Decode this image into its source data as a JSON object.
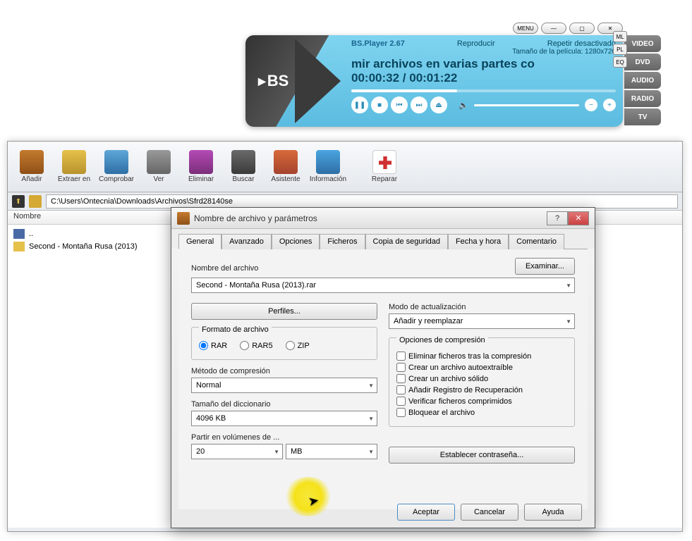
{
  "bsplayer": {
    "app_name": "BS.Player 2.67",
    "reproduce": "Reproducir",
    "repeat": "Repetir desactivado",
    "size_label": "Tamaño de la película: 1280x720",
    "ml": "ML",
    "pl": "PL",
    "eq": "EQ",
    "media_title": "mir archivos en varias partes co",
    "time_current": "00:00:32",
    "time_total": "00:01:22",
    "menu": "MENU",
    "tabs": {
      "video": "VIDEO",
      "dvd": "DVD",
      "audio": "AUDIO",
      "radio": "RADIO",
      "tv": "TV"
    }
  },
  "winrar": {
    "toolbar": {
      "add": "Añadir",
      "extract": "Extraer en",
      "test": "Comprobar",
      "view": "Ver",
      "delete": "Eliminar",
      "find": "Buscar",
      "wizard": "Asistente",
      "info": "Información",
      "repair": "Reparar"
    },
    "path": "C:\\Users\\Ontecnia\\Downloads\\Archivos\\Sfrd28140se",
    "column_name": "Nombre",
    "items": {
      "up": "..",
      "folder1": "Second - Montaña Rusa (2013)"
    }
  },
  "dialog": {
    "title": "Nombre de archivo y parámetros",
    "tabs": {
      "general": "General",
      "advanced": "Avanzado",
      "options": "Opciones",
      "files": "Ficheros",
      "backup": "Copia de seguridad",
      "time": "Fecha y hora",
      "comment": "Comentario"
    },
    "filename_label": "Nombre del archivo",
    "filename_value": "Second - Montaña Rusa (2013).rar",
    "browse_btn": "Examinar...",
    "profiles_btn": "Perfiles...",
    "update_label": "Modo de actualización",
    "update_value": "Añadir y reemplazar",
    "format_label": "Formato de archivo",
    "formats": {
      "rar": "RAR",
      "rar5": "RAR5",
      "zip": "ZIP"
    },
    "method_label": "Método de compresión",
    "method_value": "Normal",
    "dict_label": "Tamaño del diccionario",
    "dict_value": "4096 KB",
    "split_label": "Partir en volúmenes de ...",
    "split_value": "20",
    "split_unit": "MB",
    "comp_options_label": "Opciones de compresión",
    "comp_opts": {
      "delete": "Eliminar ficheros tras la compresión",
      "sfx": "Crear un archivo autoextraíble",
      "solid": "Crear un archivo sólido",
      "recovery": "Añadir Registro de Recuperación",
      "verify": "Verificar ficheros comprimidos",
      "lock": "Bloquear el archivo"
    },
    "password_btn": "Establecer contraseña...",
    "ok": "Aceptar",
    "cancel": "Cancelar",
    "help": "Ayuda"
  }
}
